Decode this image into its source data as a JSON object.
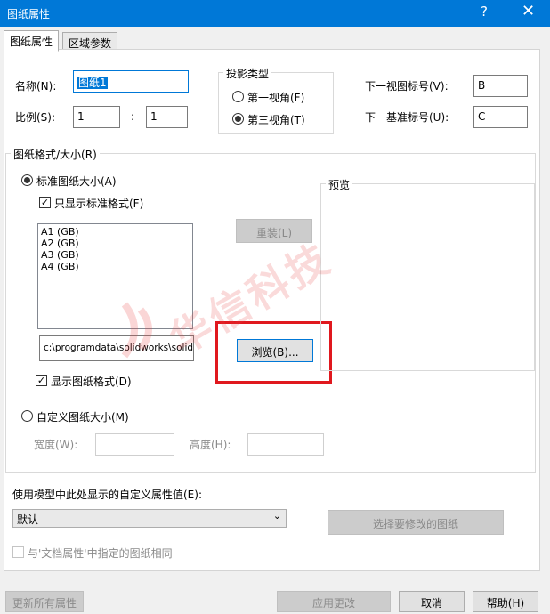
{
  "window": {
    "title": "图纸属性",
    "help_icon": "?",
    "close_icon": "✕"
  },
  "tabs": [
    "图纸属性",
    "区域参数"
  ],
  "fields": {
    "name_label": "名称(N):",
    "name_value": "图纸1",
    "scale_label": "比例(S):",
    "scale_a": "1",
    "scale_sep": ":",
    "scale_b": "1"
  },
  "projection": {
    "title": "投影类型",
    "first_angle": "第一视角(F)",
    "third_angle": "第三视角(T)",
    "selected": "third_angle"
  },
  "next_view": {
    "label": "下一视图标号(V):",
    "value": "B"
  },
  "next_datum": {
    "label": "下一基准标号(U):",
    "value": "C"
  },
  "sheet_format": {
    "title": "图纸格式/大小(R)",
    "standard_label": "标准图纸大小(A)",
    "only_standard_label": "只显示标准格式(F)",
    "sizes": [
      "A1 (GB)",
      "A2 (GB)",
      "A3 (GB)",
      "A4 (GB)"
    ],
    "reload_label": "重装(L)",
    "path_value": "c:\\programdata\\solidworks\\solid",
    "browse_label": "浏览(B)...",
    "show_format_label": "显示图纸格式(D)",
    "custom_label": "自定义图纸大小(M)",
    "width_label": "宽度(W):",
    "height_label": "高度(H):",
    "preview_label": "预览"
  },
  "custom_property": {
    "label": "使用模型中此处显示的自定义属性值(E):",
    "dropdown_value": "默认",
    "select_sheets_label": "选择要修改的图纸",
    "same_as_doc_label": "与'文档属性'中指定的图纸相同"
  },
  "footer": {
    "update_all": "更新所有属性",
    "apply": "应用更改",
    "cancel": "取消",
    "help": "帮助(H)"
  },
  "watermark": {
    "text": "华信科技"
  },
  "colors": {
    "titlebar": "#0078d7",
    "highlight": "#e0181e"
  }
}
